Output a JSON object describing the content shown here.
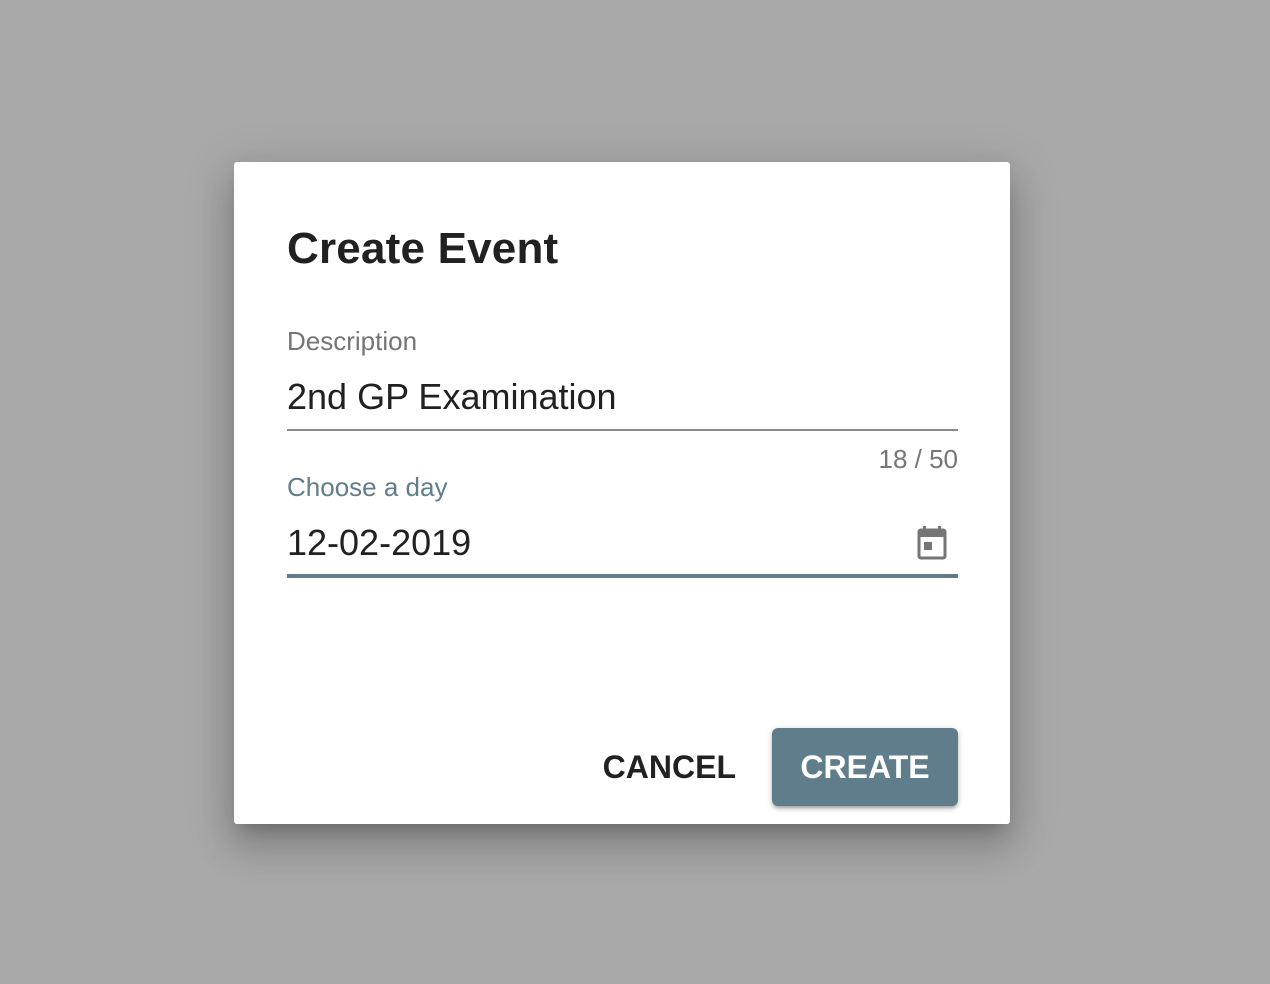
{
  "dialog": {
    "title": "Create Event",
    "description_field": {
      "label": "Description",
      "value": "2nd GP Examination",
      "counter": "18 / 50"
    },
    "date_field": {
      "label": "Choose a day",
      "value": "12-02-2019",
      "icon": "calendar-icon"
    },
    "actions": {
      "cancel_label": "CANCEL",
      "create_label": "CREATE"
    }
  },
  "colors": {
    "backdrop": "#a9a9a9",
    "primary": "#607d8b",
    "text": "#212121",
    "secondary_text": "#757575"
  }
}
